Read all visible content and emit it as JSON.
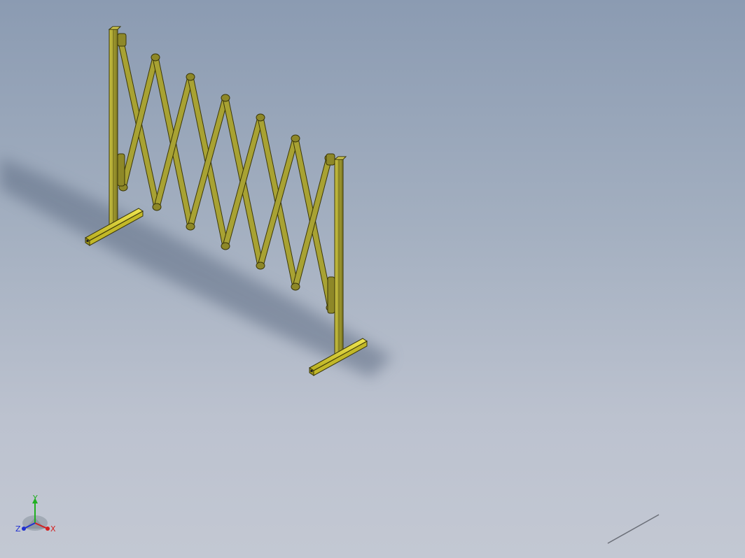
{
  "viewport": {
    "name": "3d-graphics-area",
    "background_top": "#8b9bb2",
    "background_bottom": "#c3c8d3"
  },
  "model": {
    "name": "expandable-scissor-barrier",
    "color": "#a8a233",
    "edge_color": "#3a3608",
    "foot_color": "#d8cf34"
  },
  "triad": {
    "x_label": "X",
    "y_label": "Y",
    "z_label": "Z",
    "x_color": "#d42020",
    "y_color": "#20b020",
    "z_color": "#2030d0"
  }
}
